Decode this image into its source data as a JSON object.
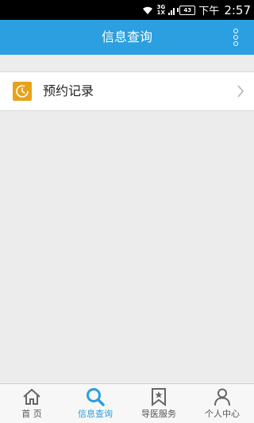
{
  "status_bar": {
    "network_top": "3G",
    "network_bottom": "1X",
    "battery": "43",
    "ampm": "下午",
    "time": "2:57"
  },
  "header": {
    "title": "信息查询",
    "menu_icon": "more-vertical-icon"
  },
  "list": {
    "items": [
      {
        "label": "预约记录",
        "icon": "clock-icon",
        "chevron": "chevron-right-icon"
      }
    ]
  },
  "bottom_nav": {
    "items": [
      {
        "label": "首 页",
        "icon": "home-icon",
        "active": false
      },
      {
        "label": "信息查询",
        "icon": "search-icon",
        "active": true
      },
      {
        "label": "导医服务",
        "icon": "bookmark-star-icon",
        "active": false
      },
      {
        "label": "个人中心",
        "icon": "person-icon",
        "active": false
      }
    ]
  },
  "colors": {
    "accent": "#2b9fe0",
    "record_icon": "#e8a21a",
    "background": "#ececec"
  }
}
